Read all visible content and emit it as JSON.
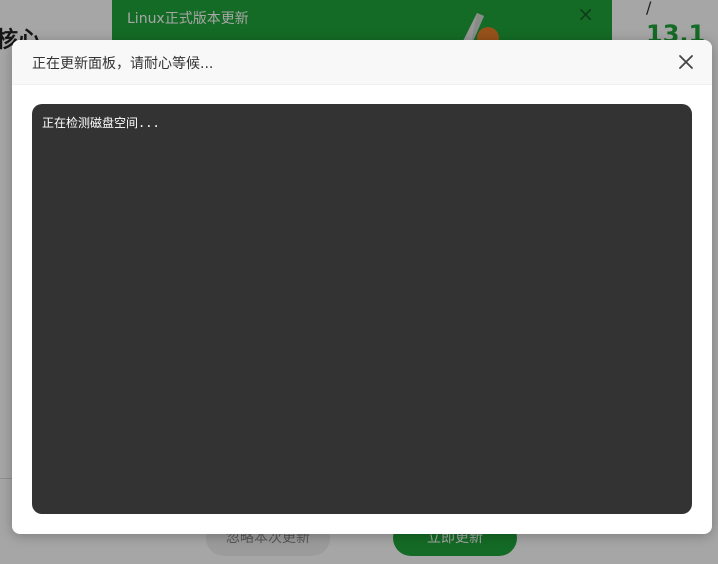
{
  "background": {
    "left_text": "核心",
    "right_slash": "/",
    "right_num": "13.1",
    "update_dialog": {
      "title": "Linux正式版本更新",
      "close_label": "×",
      "ignore_button": "忽略本次更新",
      "update_now_button": "立即更新"
    }
  },
  "progress_modal": {
    "title": "正在更新面板，请耐心等候...",
    "console_lines": [
      "正在检测磁盘空间..."
    ]
  },
  "colors": {
    "brand_green": "#20a53a",
    "console_bg": "#333333"
  }
}
